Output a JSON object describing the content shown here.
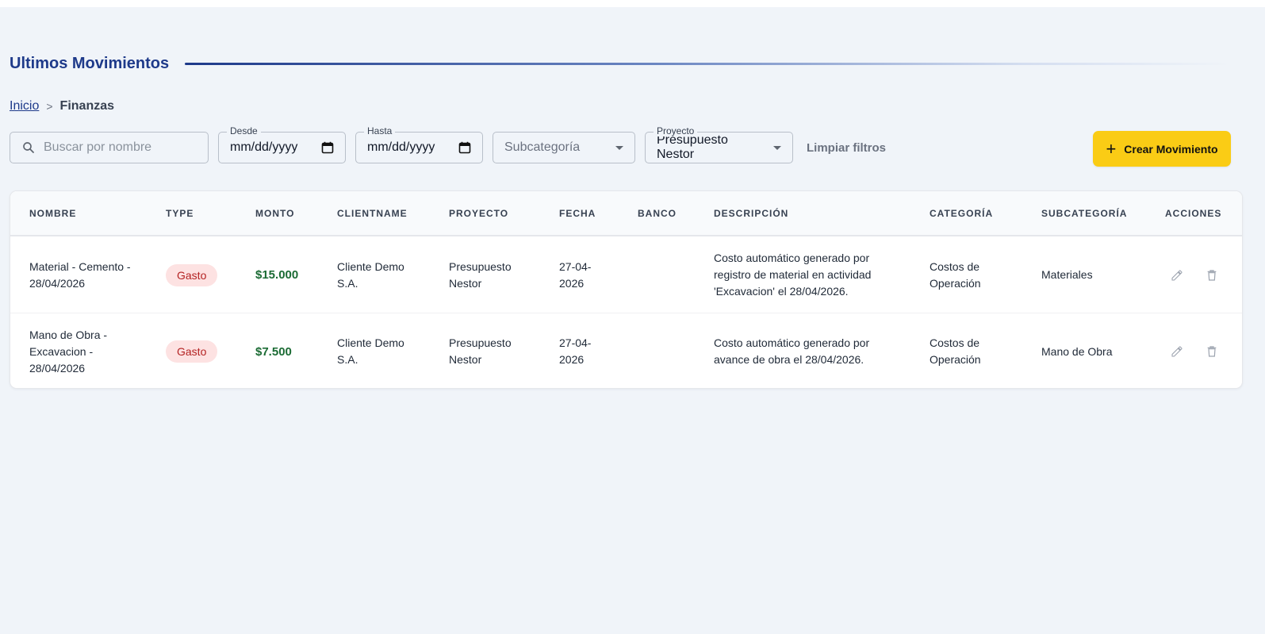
{
  "page": {
    "title": "Ultimos Movimientos"
  },
  "breadcrumb": {
    "home": "Inicio",
    "separator": ">",
    "current": "Finanzas"
  },
  "filters": {
    "search_placeholder": "Buscar por nombre",
    "desde_label": "Desde",
    "desde_value": "mm/dd/yyyy",
    "hasta_label": "Hasta",
    "hasta_value": "mm/dd/yyyy",
    "subcategoria_placeholder": "Subcategoría",
    "proyecto_label": "Proyecto",
    "proyecto_value": "Presupuesto Nestor",
    "clear_label": "Limpiar filtros"
  },
  "actions": {
    "create_label": "Crear Movimiento"
  },
  "table": {
    "headers": {
      "nombre": "NOMBRE",
      "type": "TYPE",
      "monto": "MONTO",
      "clientname": "CLIENTNAME",
      "proyecto": "PROYECTO",
      "fecha": "FECHA",
      "banco": "BANCO",
      "descripcion": "DESCRIPCIÓN",
      "categoria": "CATEGORÍA",
      "subcategoria": "SUBCATEGORÍA",
      "acciones": "ACCIONES"
    },
    "rows": [
      {
        "nombre": "Material - Cemento - 28/04/2026",
        "type": "Gasto",
        "monto": "$15.000",
        "clientname": "Cliente Demo S.A.",
        "proyecto": "Presupuesto Nestor",
        "fecha": "27-04-2026",
        "banco": "",
        "descripcion": "Costo automático generado por registro de material en actividad 'Excavacion' el 28/04/2026.",
        "categoria": "Costos de Operación",
        "subcategoria": "Materiales"
      },
      {
        "nombre": "Mano de Obra - Excavacion - 28/04/2026",
        "type": "Gasto",
        "monto": "$7.500",
        "clientname": "Cliente Demo S.A.",
        "proyecto": "Presupuesto Nestor",
        "fecha": "27-04-2026",
        "banco": "",
        "descripcion": "Costo automático generado por avance de obra el 28/04/2026.",
        "categoria": "Costos de Operación",
        "subcategoria": "Mano de Obra"
      }
    ]
  },
  "icons": {
    "search": "search-icon",
    "calendar": "calendar-icon",
    "dropdown": "chevron-down-icon",
    "add": "plus-icon",
    "edit": "pencil-icon",
    "delete": "trash-icon"
  },
  "colors": {
    "title": "#1e3a8a",
    "primary_button": "#facc15",
    "badge_bg": "#fde2e2",
    "badge_text": "#b42323",
    "amount": "#1b6b34",
    "background": "#f0f4f9"
  }
}
